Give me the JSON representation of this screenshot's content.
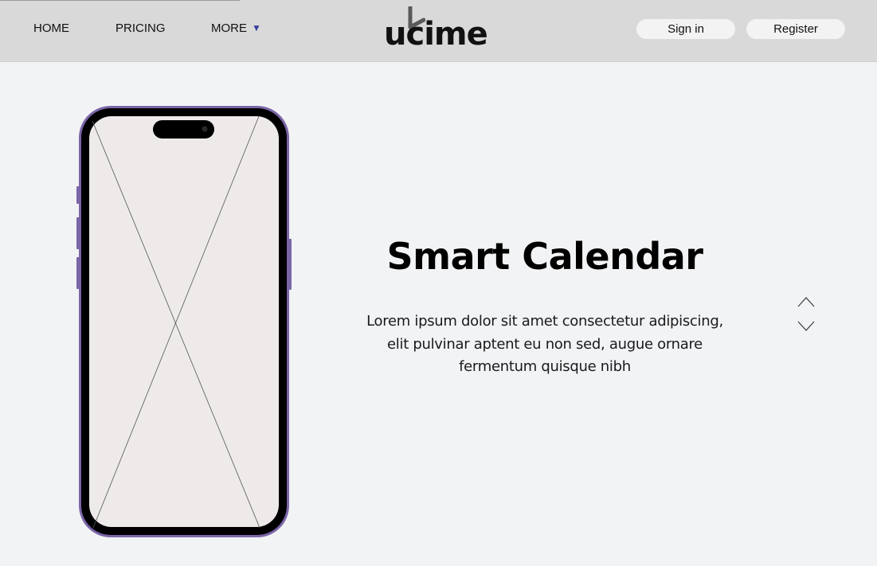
{
  "nav": {
    "home": "HOME",
    "pricing": "PRICING",
    "more": "MORE"
  },
  "brand": {
    "name": "ucime",
    "logo_icon": "clock-hand-icon"
  },
  "auth": {
    "signin_label": "Sign in",
    "register_label": "Register"
  },
  "hero": {
    "title": "Smart Calendar",
    "description_lines": [
      "Lorem ipsum dolor sit amet consectetur adipiscing,",
      "elit pulvinar aptent eu non sed, augue ornare",
      "fermentum quisque nibh"
    ]
  },
  "phone": {
    "image_placeholder": "image-placeholder-icon"
  },
  "carousel": {
    "up_icon": "chevron-up-icon",
    "down_icon": "chevron-down-icon"
  },
  "colors": {
    "header_bg": "#d9d9d9",
    "page_bg": "#f2f3f5",
    "accent": "#3b3fa0",
    "phone_frame": "#7a65a8"
  }
}
